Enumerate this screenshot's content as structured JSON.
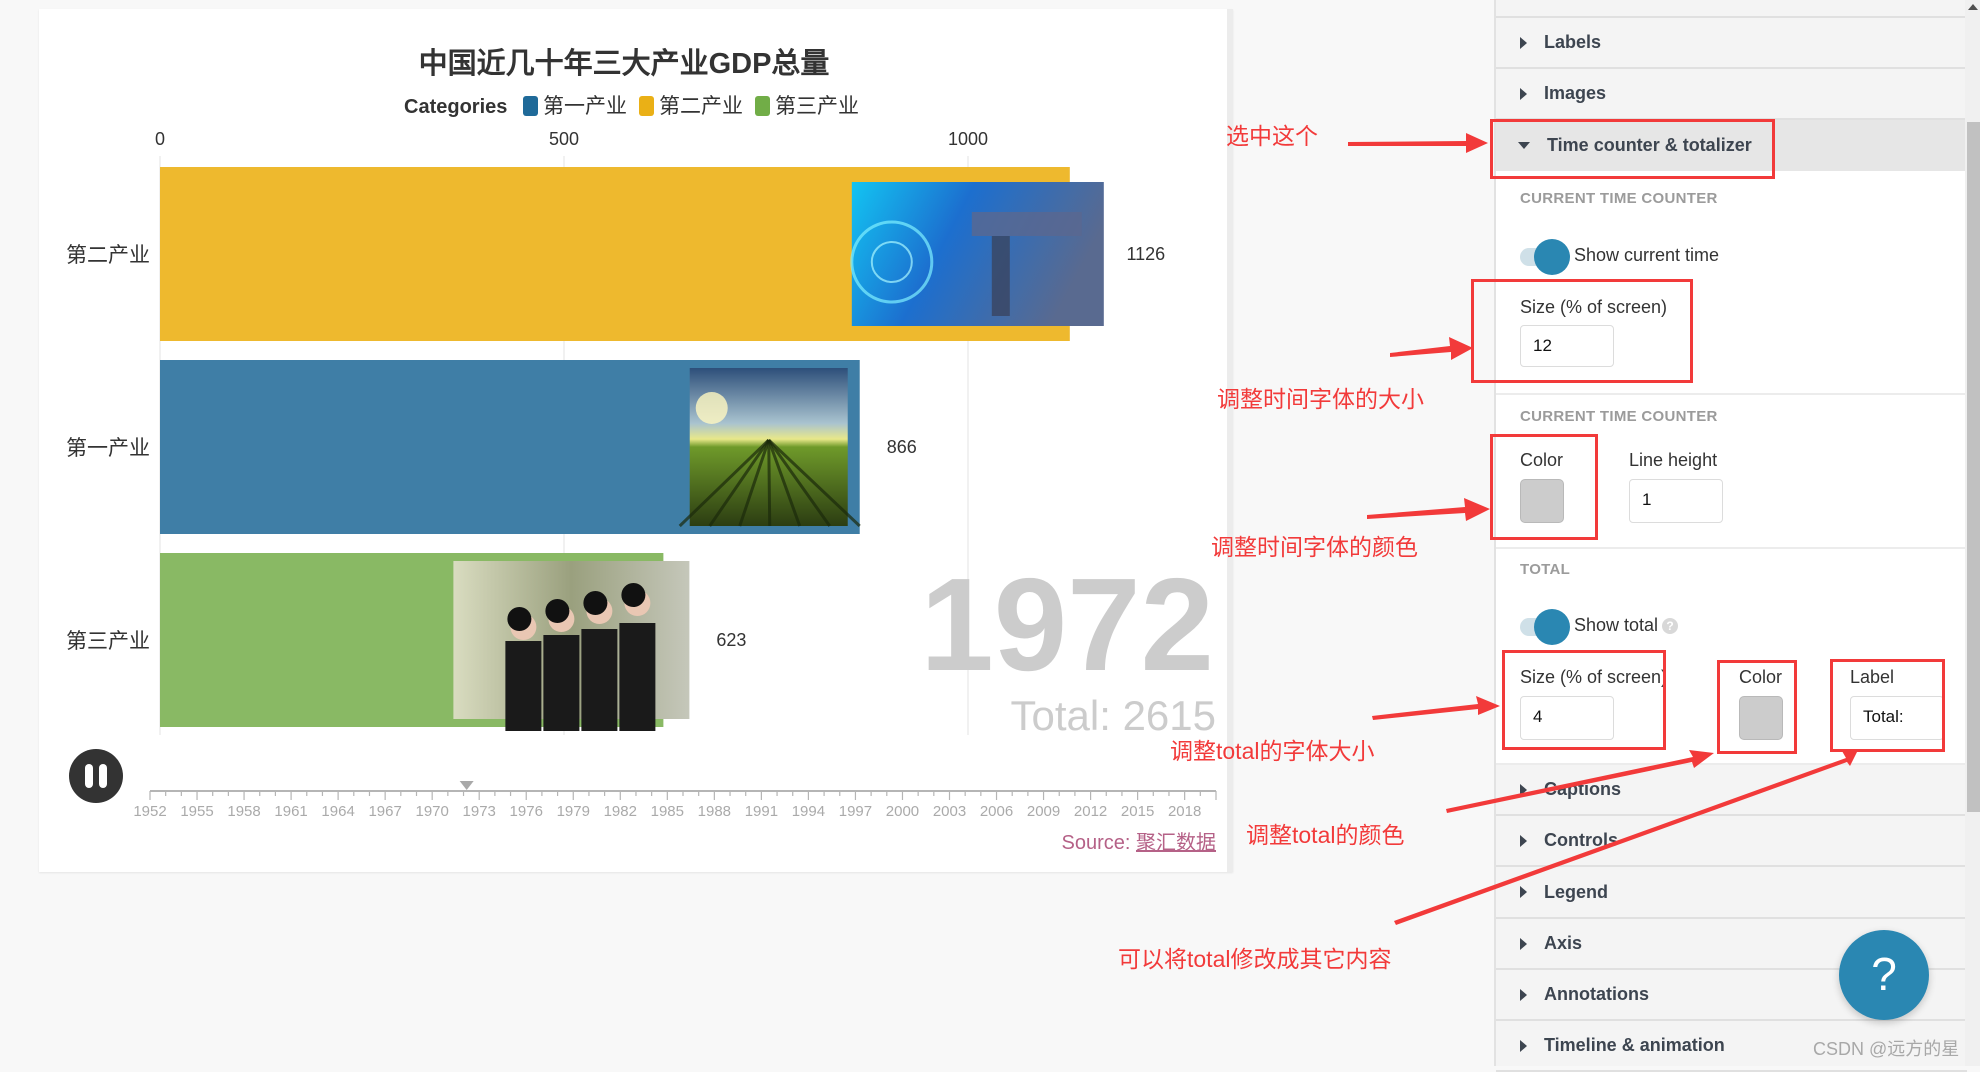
{
  "chart_data": {
    "type": "bar",
    "orientation": "horizontal",
    "title": "中国近几十年三大产业GDP总量",
    "legend": {
      "title": "Categories",
      "placement": "top",
      "items": [
        {
          "name": "第一产业",
          "color": "#1f6a99"
        },
        {
          "name": "第二产业",
          "color": "#eab016"
        },
        {
          "name": "第三产业",
          "color": "#71ad47"
        }
      ]
    },
    "categories": [
      "第二产业",
      "第一产业",
      "第三产业"
    ],
    "values": [
      1126,
      866,
      623
    ],
    "bar_colors": [
      "#eeb92e",
      "#3f7ea6",
      "#89b964"
    ],
    "value_labels": [
      "1126",
      "866",
      "623"
    ],
    "bar_images": [
      "technology-machinery-photo",
      "farmland-sunrise-photo",
      "business-women-photo"
    ],
    "x_axis": {
      "position": "top",
      "ticks": [
        0,
        500,
        1000
      ],
      "tick_labels": [
        "0",
        "500",
        "1000"
      ],
      "range": [
        0,
        1240
      ]
    },
    "grid": true,
    "current_time": "1972",
    "total_label": "Total:",
    "total_value": "2615",
    "timeline": {
      "start": 1952,
      "end": 2020,
      "current": 1972,
      "tick_labels": [
        "1952",
        "1955",
        "1958",
        "1961",
        "1964",
        "1967",
        "1970",
        "1973",
        "1976",
        "1979",
        "1982",
        "1985",
        "1988",
        "1991",
        "1994",
        "1997",
        "2000",
        "2003",
        "2006",
        "2009",
        "2012",
        "2015",
        "2018"
      ]
    },
    "source_prefix": "Source: ",
    "source_link": "聚汇数据"
  },
  "player": {
    "pause_icon": "pause-icon"
  },
  "panel": {
    "accordion_top": [
      {
        "label": "Labels",
        "open": false
      },
      {
        "label": "Images",
        "open": false
      },
      {
        "label": "Time counter & totalizer",
        "open": true
      }
    ],
    "time_counter": {
      "heading": "CURRENT TIME COUNTER",
      "show_label": "Show current time",
      "show_on": true,
      "size_label": "Size (% of screen)",
      "size_value": "12"
    },
    "time_counter_style": {
      "heading": "CURRENT TIME COUNTER",
      "color_label": "Color",
      "color_value": "#cccccc",
      "line_height_label": "Line height",
      "line_height_value": "1"
    },
    "total": {
      "heading": "TOTAL",
      "show_label": "Show total",
      "show_on": true,
      "help_icon": "?",
      "size_label": "Size (% of screen)",
      "size_value": "4",
      "color_label": "Color",
      "color_value": "#cccccc",
      "label_label": "Label",
      "label_value": "Total:"
    },
    "accordion_bottom": [
      {
        "label": "Captions"
      },
      {
        "label": "Controls"
      },
      {
        "label": "Legend"
      },
      {
        "label": "Axis"
      },
      {
        "label": "Annotations"
      },
      {
        "label": "Timeline & animation"
      }
    ]
  },
  "help_button": "?",
  "watermark": "CSDN @远方的星",
  "annotations": [
    "选中这个",
    "调整时间字体的大小",
    "调整时间字体的颜色",
    "调整total的字体大小",
    "调整total的颜色",
    "可以将total修改成其它内容"
  ]
}
